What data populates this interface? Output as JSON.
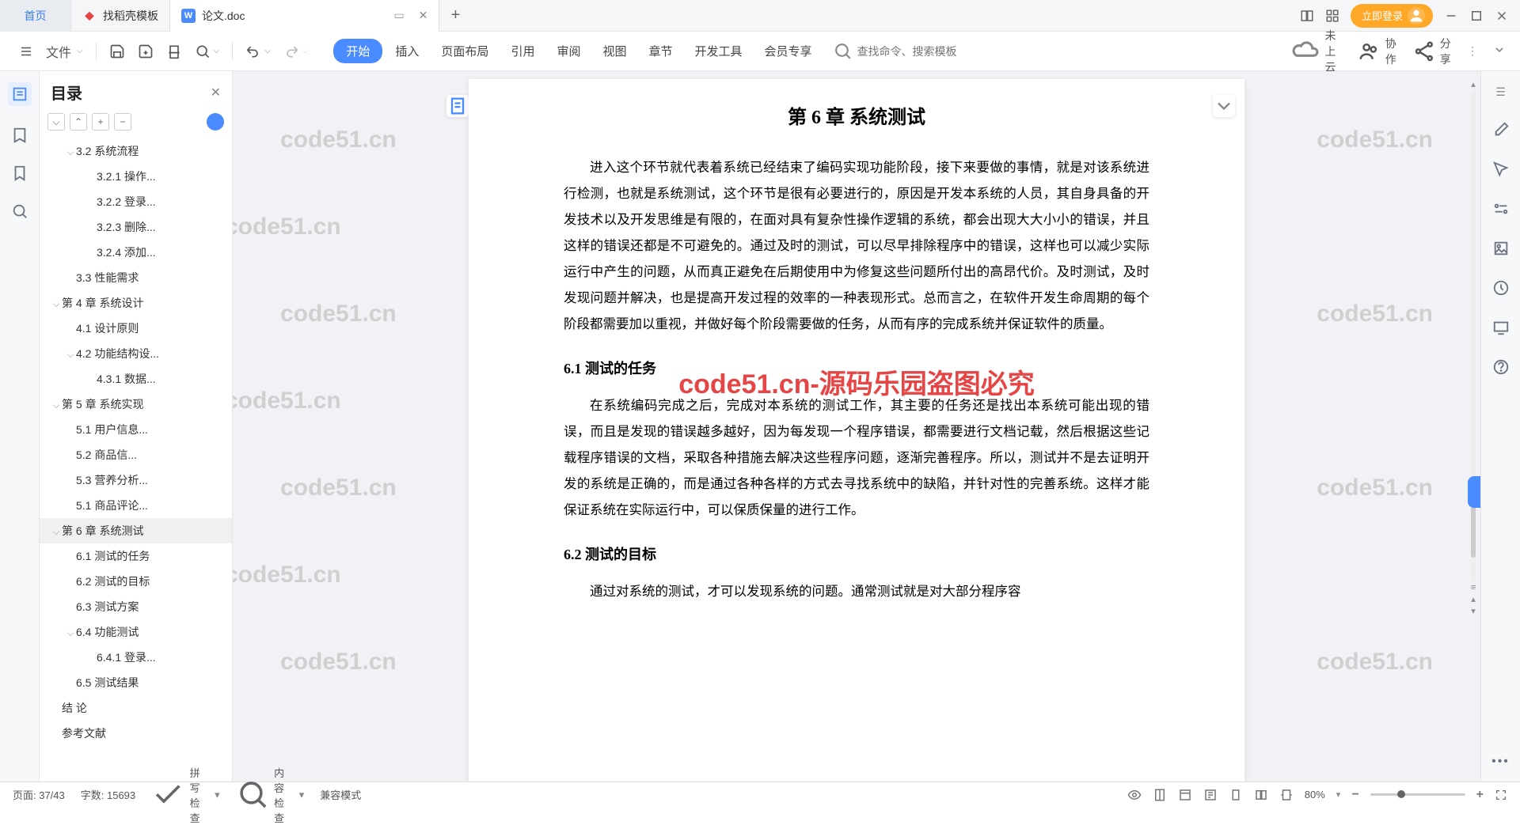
{
  "tabs": {
    "home": "首页",
    "t1": "找稻壳模板",
    "t2": "论文.doc",
    "add": "+"
  },
  "login": "立即登录",
  "menubar": {
    "file": "文件",
    "items": [
      "开始",
      "插入",
      "页面布局",
      "引用",
      "审阅",
      "视图",
      "章节",
      "开发工具",
      "会员专享"
    ],
    "search_ph": "查找命令、搜索模板"
  },
  "right_tools": {
    "cloud": "未上云",
    "collab": "协作",
    "share": "分享"
  },
  "outline": {
    "title": "目录",
    "items": [
      {
        "lv": 2,
        "t": "3.2 系统流程",
        "c": 1
      },
      {
        "lv": 3,
        "t": "3.2.1 操作..."
      },
      {
        "lv": 3,
        "t": "3.2.2 登录..."
      },
      {
        "lv": 3,
        "t": "3.2.3 删除..."
      },
      {
        "lv": 3,
        "t": "3.2.4 添加..."
      },
      {
        "lv": 2,
        "t": "3.3 性能需求"
      },
      {
        "lv": 1,
        "t": "第 4 章  系统设计",
        "c": 1
      },
      {
        "lv": 2,
        "t": "4.1 设计原则"
      },
      {
        "lv": 2,
        "t": "4.2 功能结构设...",
        "c": 1
      },
      {
        "lv": 3,
        "t": "4.3.1 数据..."
      },
      {
        "lv": 1,
        "t": "第 5 章  系统实现",
        "c": 1
      },
      {
        "lv": 2,
        "t": "5.1 用户信息..."
      },
      {
        "lv": 2,
        "t": "5.2 商品信..."
      },
      {
        "lv": 2,
        "t": "5.3 营养分析..."
      },
      {
        "lv": 2,
        "t": "5.1 商品评论..."
      },
      {
        "lv": 1,
        "t": "第 6 章  系统测试",
        "c": 1,
        "sel": 1
      },
      {
        "lv": 2,
        "t": "6.1 测试的任务"
      },
      {
        "lv": 2,
        "t": "6.2 测试的目标"
      },
      {
        "lv": 2,
        "t": "6.3 测试方案"
      },
      {
        "lv": 2,
        "t": "6.4 功能测试",
        "c": 1
      },
      {
        "lv": 3,
        "t": "6.4.1 登录..."
      },
      {
        "lv": 2,
        "t": "6.5 测试结果"
      },
      {
        "lv": 0,
        "t": "结    论"
      },
      {
        "lv": 0,
        "t": "参考文献"
      }
    ]
  },
  "doc": {
    "h1": "第 6 章  系统测试",
    "p1": "进入这个环节就代表着系统已经结束了编码实现功能阶段，接下来要做的事情，就是对该系统进行检测，也就是系统测试，这个环节是很有必要进行的，原因是开发本系统的人员，其自身具备的开发技术以及开发思维是有限的，在面对具有复杂性操作逻辑的系统，都会出现大大小小的错误，并且这样的错误还都是不可避免的。通过及时的测试，可以尽早排除程序中的错误，这样也可以减少实际运行中产生的问题，从而真正避免在后期使用中为修复这些问题所付出的高昂代价。及时测试，及时发现问题并解决，也是提高开发过程的效率的一种表现形式。总而言之，在软件开发生命周期的每个阶段都需要加以重视，并做好每个阶段需要做的任务，从而有序的完成系统并保证软件的质量。",
    "h2a": "6.1  测试的任务",
    "p2": "在系统编码完成之后，完成对本系统的测试工作，其主要的任务还是找出本系统可能出现的错误，而且是发现的错误越多越好，因为每发现一个程序错误，都需要进行文档记载，然后根据这些记载程序错误的文档，采取各种措施去解决这些程序问题，逐渐完善程序。所以，测试并不是去证明开发的系统是正确的，而是通过各种各样的方式去寻找系统中的缺陷，并针对性的完善系统。这样才能保证系统在实际运行中，可以保质保量的进行工作。",
    "h2b": "6.2  测试的目标",
    "p3": "通过对系统的测试，才可以发现系统的问题。通常测试就是对大部分程序容",
    "wm_red": "code51.cn-源码乐园盗图必究",
    "wm_grey": "code51.cn"
  },
  "status": {
    "page": "页面: 37/43",
    "words": "字数: 15693",
    "spell": "拼写检查",
    "content": "内容检查",
    "compat": "兼容模式",
    "zoom": "80%"
  }
}
